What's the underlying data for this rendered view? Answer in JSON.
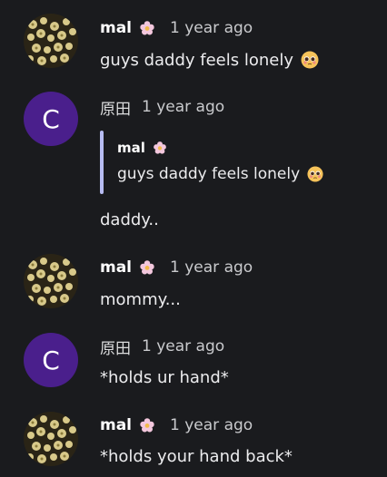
{
  "messages": [
    {
      "author": "mal",
      "timestamp": "1 year ago",
      "text": "guys daddy feels lonely",
      "avatar_icon": "flower-field-avatar",
      "badge_icon": "flower-emoji",
      "emoji": "pleading-face-emoji"
    },
    {
      "author": "原田",
      "timestamp": "1 year ago",
      "avatar_letter": "C",
      "avatar_color": "#4a1f8c",
      "quote": {
        "author": "mal",
        "text": "guys daddy feels lonely",
        "badge_icon": "flower-emoji",
        "emoji": "pleading-face-emoji"
      },
      "text": "daddy.."
    },
    {
      "author": "mal",
      "timestamp": "1 year ago",
      "text": "mommy...",
      "avatar_icon": "flower-field-avatar",
      "badge_icon": "flower-emoji"
    },
    {
      "author": "原田",
      "timestamp": "1 year ago",
      "avatar_letter": "C",
      "avatar_color": "#4a1f8c",
      "text": "*holds ur hand*"
    },
    {
      "author": "mal",
      "timestamp": "1 year ago",
      "text": "*holds your hand back*",
      "avatar_icon": "flower-field-avatar",
      "badge_icon": "flower-emoji"
    }
  ],
  "colors": {
    "background": "#1a1b1e",
    "quote_bar": "#b7bcf2",
    "avatar_purple": "#4a1f8c"
  }
}
